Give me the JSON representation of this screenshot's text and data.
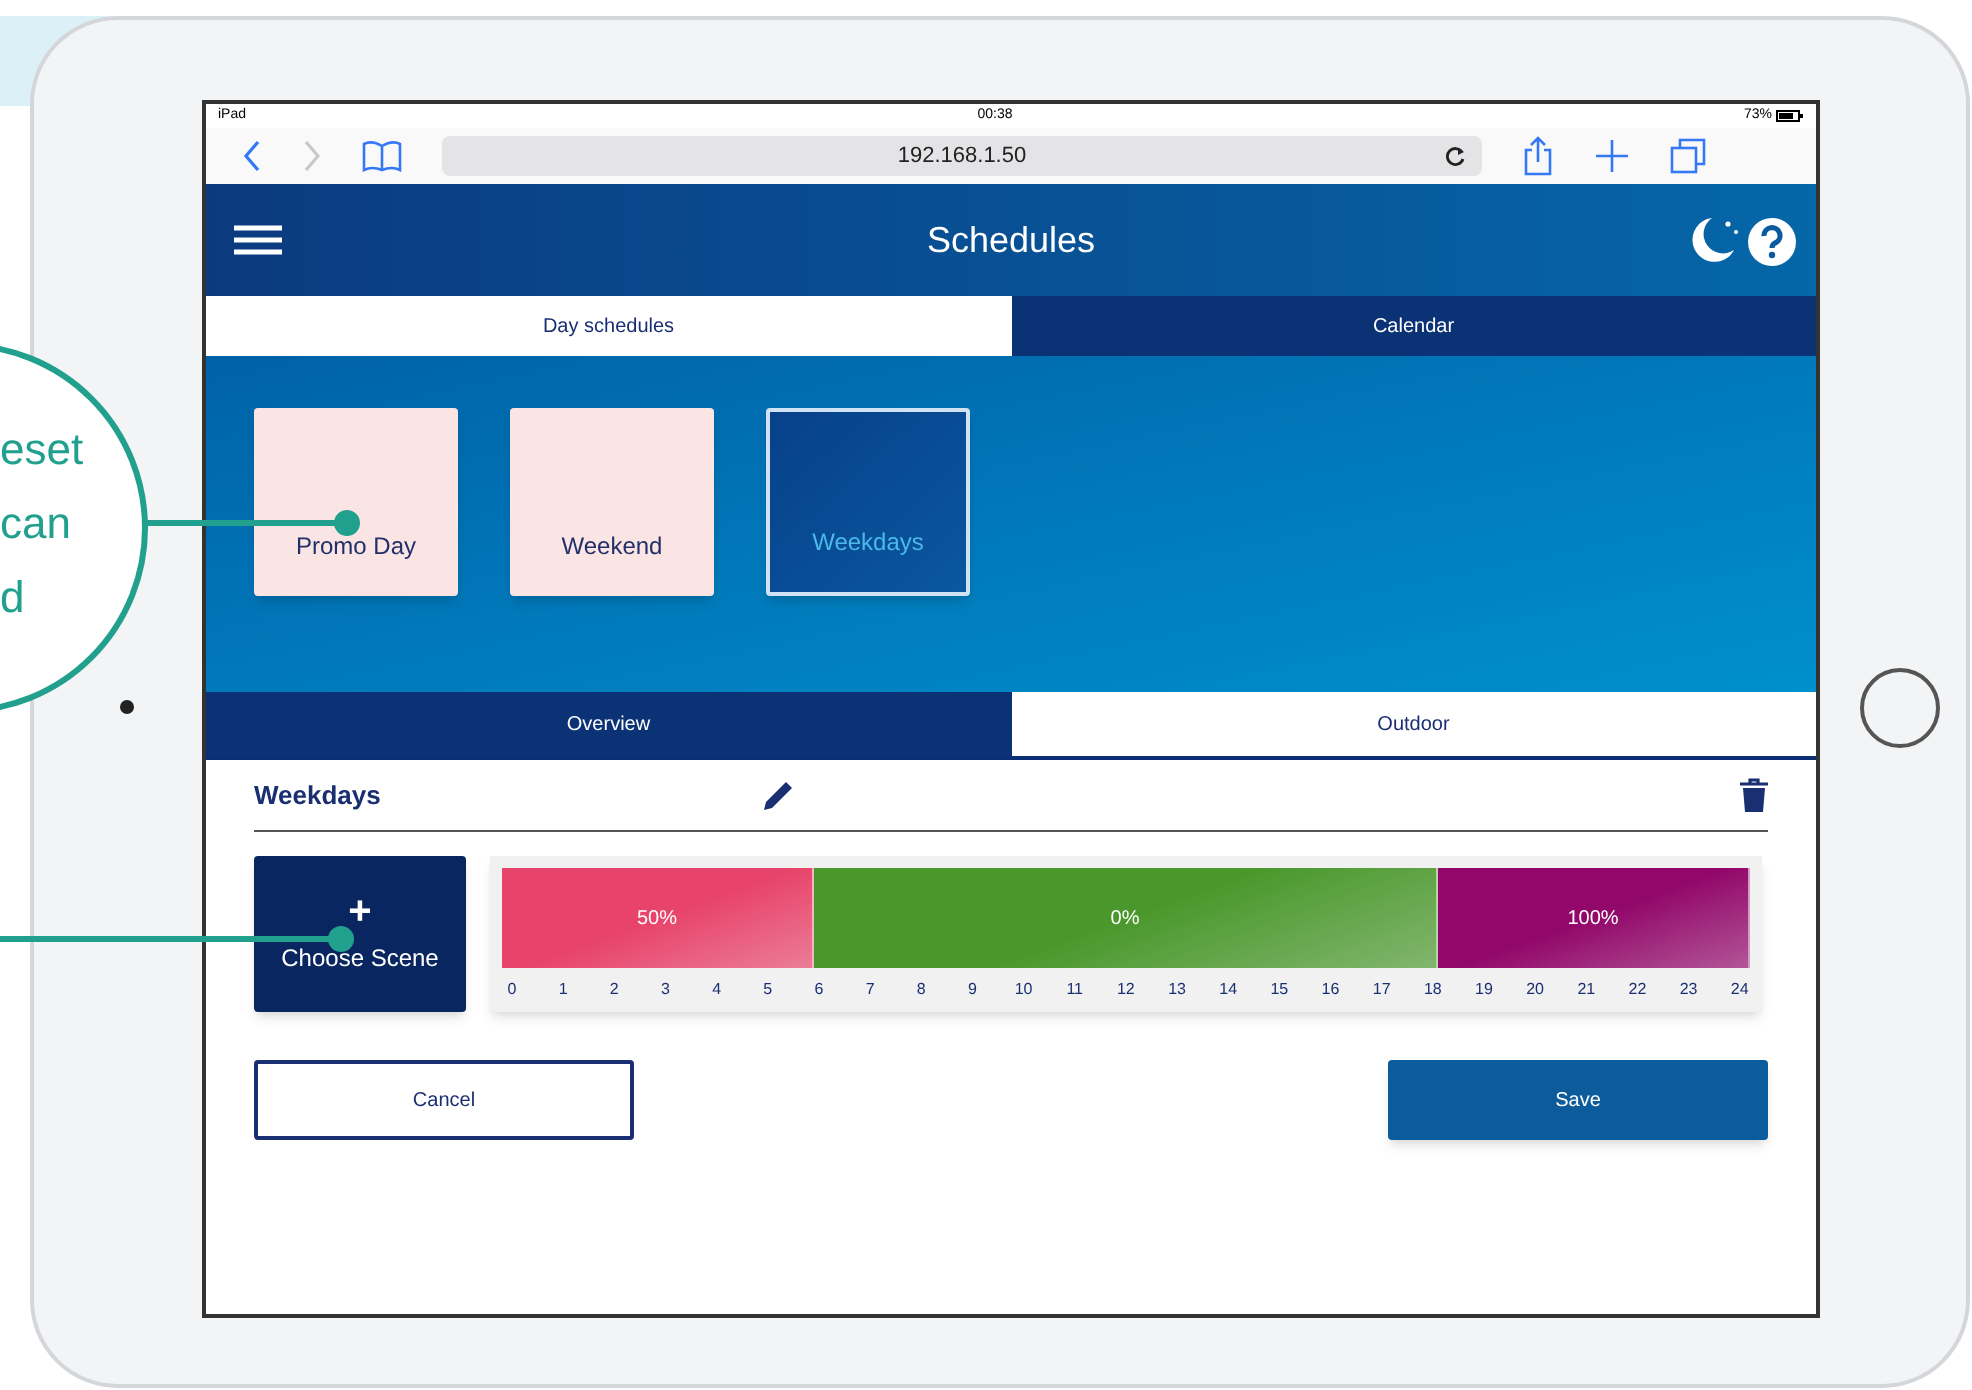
{
  "status_bar": {
    "device": "iPad",
    "time": "00:38",
    "battery": "73%"
  },
  "browser": {
    "url": "192.168.1.50"
  },
  "header": {
    "title": "Schedules"
  },
  "tabs": [
    {
      "label": "Day schedules",
      "selected": true
    },
    {
      "label": "Calendar",
      "selected": false
    }
  ],
  "schedules": [
    {
      "label": "Promo Day",
      "selected": false
    },
    {
      "label": "Weekend",
      "selected": false
    },
    {
      "label": "Weekdays",
      "selected": true
    }
  ],
  "view_tabs": [
    {
      "label": "Overview",
      "selected": false
    },
    {
      "label": "Outdoor",
      "selected": true
    }
  ],
  "schedule": {
    "name": "Weekdays",
    "add_label": "+",
    "add_caption": "Choose Scene"
  },
  "timeline": {
    "segments": [
      {
        "label": "50%",
        "level": 0.25,
        "color": "#e8436a"
      },
      {
        "label": "0%",
        "level": 0.5,
        "color": "#4a982c"
      },
      {
        "label": "100%",
        "level": 0.25,
        "color": "#92086a"
      }
    ],
    "ticks": [
      "0",
      "1",
      "2",
      "3",
      "4",
      "5",
      "6",
      "7",
      "8",
      "9",
      "10",
      "11",
      "12",
      "13",
      "14",
      "15",
      "16",
      "17",
      "18",
      "19",
      "20",
      "21",
      "22",
      "23",
      "24"
    ]
  },
  "buttons": [
    {
      "label": "Cancel",
      "kind": "secondary"
    },
    {
      "label": "Save",
      "kind": "primary"
    }
  ],
  "callout": {
    "lines": [
      "eset",
      "can",
      "d"
    ]
  }
}
